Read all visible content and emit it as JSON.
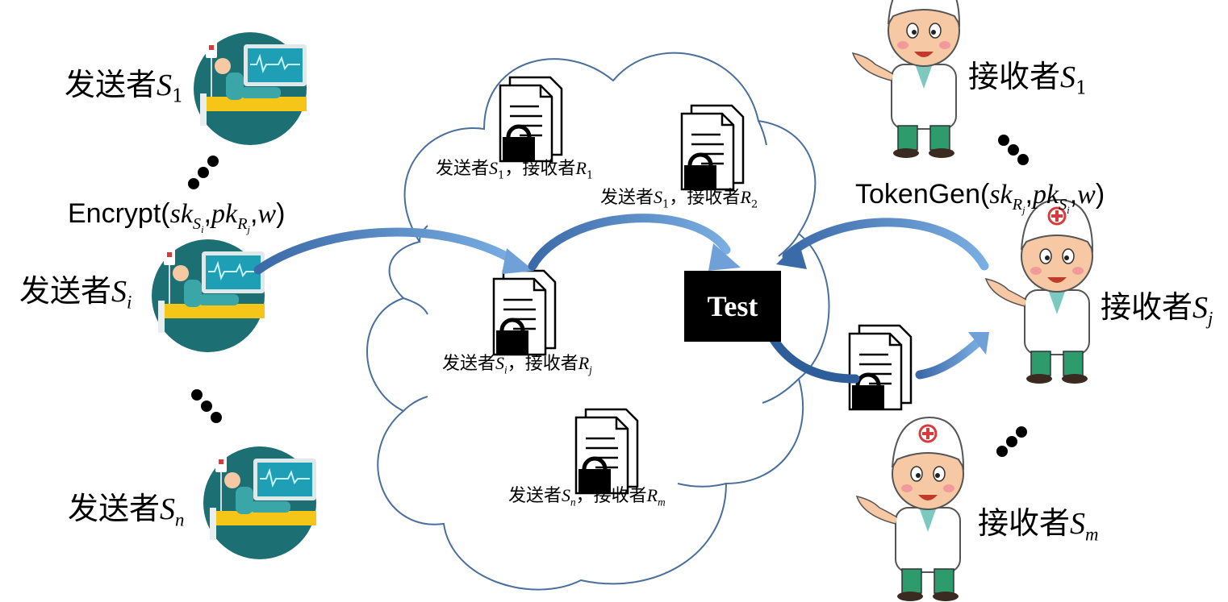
{
  "senders": [
    {
      "prefix": "发送者",
      "var": "S",
      "sub": "1"
    },
    {
      "prefix": "发送者",
      "var": "S",
      "sub": "i"
    },
    {
      "prefix": "发送者",
      "var": "S",
      "sub": "n"
    }
  ],
  "receivers": [
    {
      "prefix": "接收者",
      "var": "S",
      "sub": "1"
    },
    {
      "prefix": "接收者",
      "var": "S",
      "sub": "j"
    },
    {
      "prefix": "接收者",
      "var": "S",
      "sub": "m"
    }
  ],
  "encrypt": {
    "fn": "Encrypt(",
    "a1": "sk",
    "a1sub": "S",
    "a1subsub": "i",
    "a2": "pk",
    "a2sub": "R",
    "a2subsub": "j",
    "a3": "w",
    "close": ")"
  },
  "tokengen": {
    "fn": "TokenGen(",
    "a1": "sk",
    "a1sub": "R",
    "a1subsub": "j",
    "a2": "pk",
    "a2sub": "S",
    "a2subsub": "i",
    "a3": "w",
    "close": ")"
  },
  "cloud_docs": [
    {
      "s_prefix": "发送者",
      "s_var": "S",
      "s_sub": "1",
      "sep": "，",
      "r_prefix": "接收者",
      "r_var": "R",
      "r_sub": "1"
    },
    {
      "s_prefix": "发送者",
      "s_var": "S",
      "s_sub": "1",
      "sep": "，",
      "r_prefix": "接收者",
      "r_var": "R",
      "r_sub": "2"
    },
    {
      "s_prefix": "发送者",
      "s_var": "S",
      "s_sub": "i",
      "sep": "，",
      "r_prefix": "接收者",
      "r_var": "R",
      "r_sub": "j"
    },
    {
      "s_prefix": "发送者",
      "s_var": "S",
      "s_sub": "n",
      "sep": "，",
      "r_prefix": "接收者",
      "r_var": "R",
      "r_sub": "m"
    }
  ],
  "test_label": "Test",
  "colors": {
    "arrow": "#4a7ab8",
    "arrow_light": "#6fa0d8",
    "cloud": "#4a6f9c",
    "teal": "#1c6f73",
    "skin": "#f6c9a4",
    "yellow": "#f5c518"
  }
}
